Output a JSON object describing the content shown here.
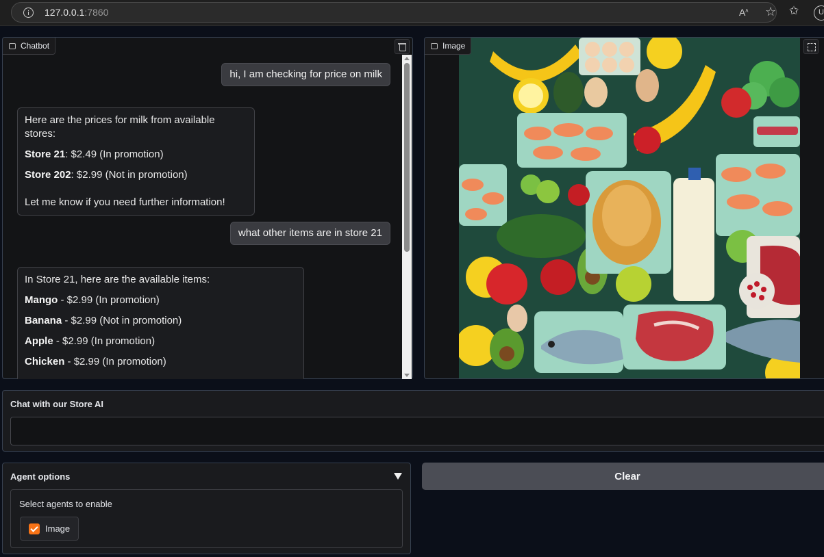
{
  "browser": {
    "url_host": "127.0.0.1",
    "url_port": ":7860",
    "profile_initial": "U"
  },
  "chatbot": {
    "label": "Chatbot",
    "messages": [
      {
        "role": "user",
        "text": "hi, I am checking for price on milk"
      },
      {
        "role": "bot",
        "lines": [
          {
            "plain": "Here are the prices for milk from available stores:"
          },
          {
            "bold": "Store 21",
            "rest": ": $2.49 (In promotion)"
          },
          {
            "bold": "Store 202",
            "rest": ": $2.99 (Not in promotion)"
          },
          {
            "plain": "Let me know if you need further information!"
          }
        ]
      },
      {
        "role": "user",
        "text": "what other items are in store 21"
      },
      {
        "role": "bot",
        "lines": [
          {
            "plain": "In Store 21, here are the available items:"
          },
          {
            "bold": "Mango",
            "rest": " - $2.99 (In promotion)"
          },
          {
            "bold": "Banana",
            "rest": " - $2.99 (Not in promotion)"
          },
          {
            "bold": "Apple",
            "rest": " - $2.99 (In promotion)"
          },
          {
            "bold": "Chicken",
            "rest": " - $2.99 (In promotion)"
          }
        ]
      }
    ]
  },
  "image_panel": {
    "label": "Image"
  },
  "input": {
    "label": "Chat with our Store AI",
    "value": "",
    "placeholder": ""
  },
  "agent_options": {
    "title": "Agent options",
    "group_label": "Select agents to enable",
    "checkbox_label": "Image",
    "checked": true
  },
  "clear_button": "Clear",
  "colors": {
    "accent_checkbox": "#f97316",
    "button_bg": "#4b4d55",
    "panel_bg": "#1a1b1e"
  }
}
